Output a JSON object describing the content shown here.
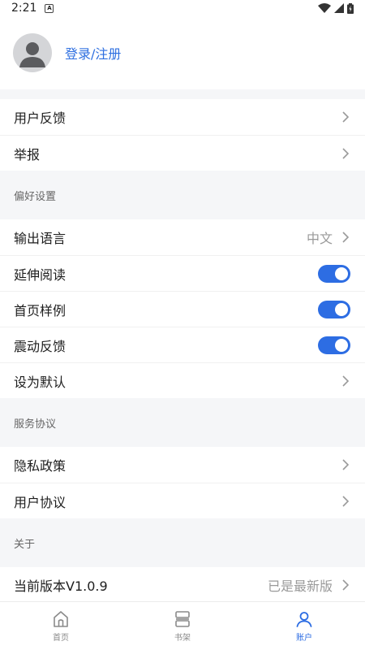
{
  "status_bar": {
    "time": "2:21"
  },
  "profile": {
    "login_label": "登录/注册"
  },
  "group1": [
    {
      "label": "用户反馈"
    },
    {
      "label": "举报"
    }
  ],
  "preferences": {
    "header": "偏好设置",
    "output_language": {
      "label": "输出语言",
      "value": "中文"
    },
    "extended_reading": {
      "label": "延伸阅读",
      "on": true
    },
    "homepage_sample": {
      "label": "首页样例",
      "on": true
    },
    "vibration_feedback": {
      "label": "震动反馈",
      "on": true
    },
    "set_default": {
      "label": "设为默认"
    }
  },
  "service": {
    "header": "服务协议",
    "privacy_policy": "隐私政策",
    "user_agreement": "用户协议"
  },
  "about": {
    "header": "关于",
    "version_label": "当前版本V1.0.9",
    "version_status": "已是最新版"
  },
  "bottom_nav": [
    {
      "label": "首页",
      "icon": "home-icon",
      "active": false
    },
    {
      "label": "书架",
      "icon": "bookshelf-icon",
      "active": false
    },
    {
      "label": "账户",
      "icon": "account-icon",
      "active": true
    }
  ],
  "colors": {
    "accent": "#2d6de3",
    "link": "#2e6fe0",
    "background": "#f5f6f8"
  }
}
